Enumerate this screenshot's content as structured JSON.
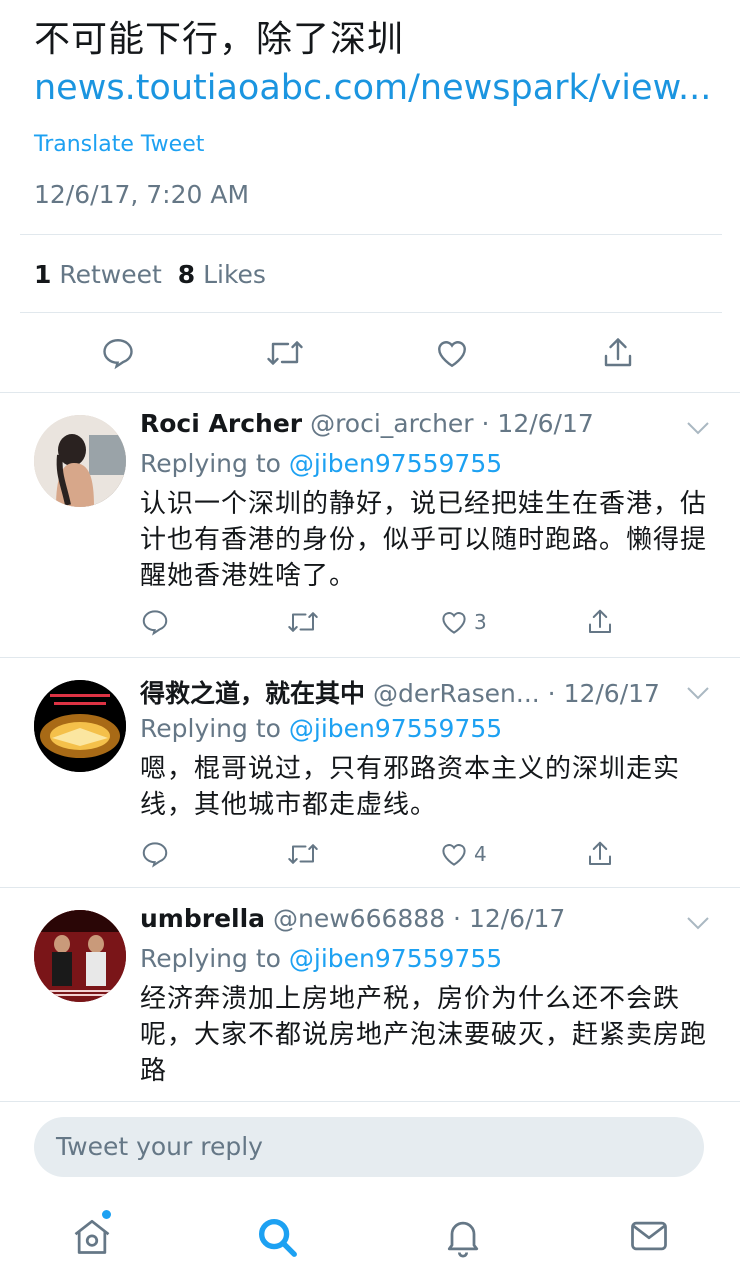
{
  "tweet": {
    "text": "不可能下行，除了深圳",
    "link": "news.toutiaoabc.com/newspark/view....",
    "translate_label": "Translate Tweet",
    "timestamp": "12/6/17, 7:20 AM",
    "retweet_count": "1",
    "retweet_label": "Retweet",
    "like_count": "8",
    "like_label": "Likes"
  },
  "replies": [
    {
      "name": "Roci Archer",
      "handle": "@roci_archer · 12/6/17",
      "replying_prefix": "Replying to",
      "replying_to": "@jiben97559755",
      "body": "认识一个深圳的静好，说已经把娃生在香港，估计也有香港的身份，似乎可以随时跑路。懒得提醒她香港姓啥了。",
      "like_count": "3"
    },
    {
      "name": "得救之道，就在其中",
      "handle": "@derRasen... · 12/6/17",
      "replying_prefix": "Replying to",
      "replying_to": "@jiben97559755",
      "body": "嗯，棍哥说过，只有邪路资本主义的深圳走实线，其他城市都走虚线。",
      "like_count": "4"
    },
    {
      "name": "umbrella",
      "handle": "@new666888 · 12/6/17",
      "replying_prefix": "Replying to",
      "replying_to": "@jiben97559755",
      "body": "经济奔溃加上房地产税，房价为什么还不会跌呢，大家不都说房地产泡沫要破灭，赶紧卖房跑路",
      "like_count": ""
    }
  ],
  "compose": {
    "placeholder": "Tweet your reply"
  },
  "tabs": [
    "home-icon",
    "search-icon",
    "notifications-icon",
    "messages-icon"
  ],
  "colors": {
    "accent": "#1da1f2",
    "link": "#1b95e0",
    "muted": "#657786",
    "divider": "#e1e8ed"
  }
}
